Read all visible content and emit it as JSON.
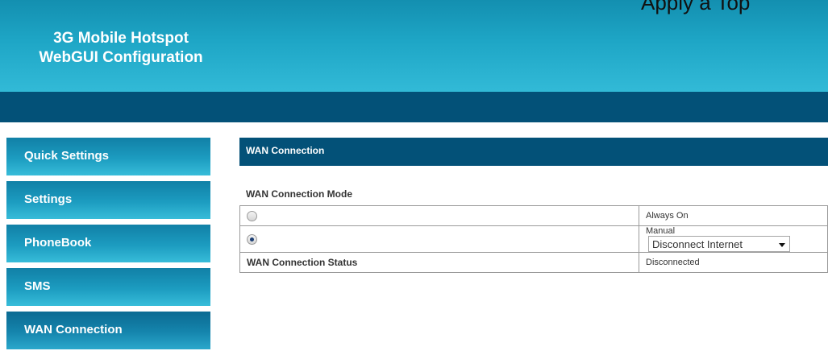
{
  "header": {
    "title_line1": "3G Mobile Hotspot",
    "title_line2": "WebGUI Configuration",
    "top_text": "Apply a Top"
  },
  "sidebar": {
    "items": [
      {
        "label": "Quick Settings"
      },
      {
        "label": "Settings"
      },
      {
        "label": "PhoneBook"
      },
      {
        "label": "SMS"
      },
      {
        "label": "WAN Connection"
      }
    ],
    "active_index": 4
  },
  "main": {
    "section_title": "WAN Connection",
    "mode_label": "WAN Connection Mode",
    "options": {
      "always_on": {
        "label": "Always On",
        "selected": false
      },
      "manual": {
        "label": "Manual",
        "selected": true,
        "select_value": "Disconnect Internet"
      }
    },
    "status": {
      "label": "WAN Connection Status",
      "value": "Disconnected"
    }
  }
}
